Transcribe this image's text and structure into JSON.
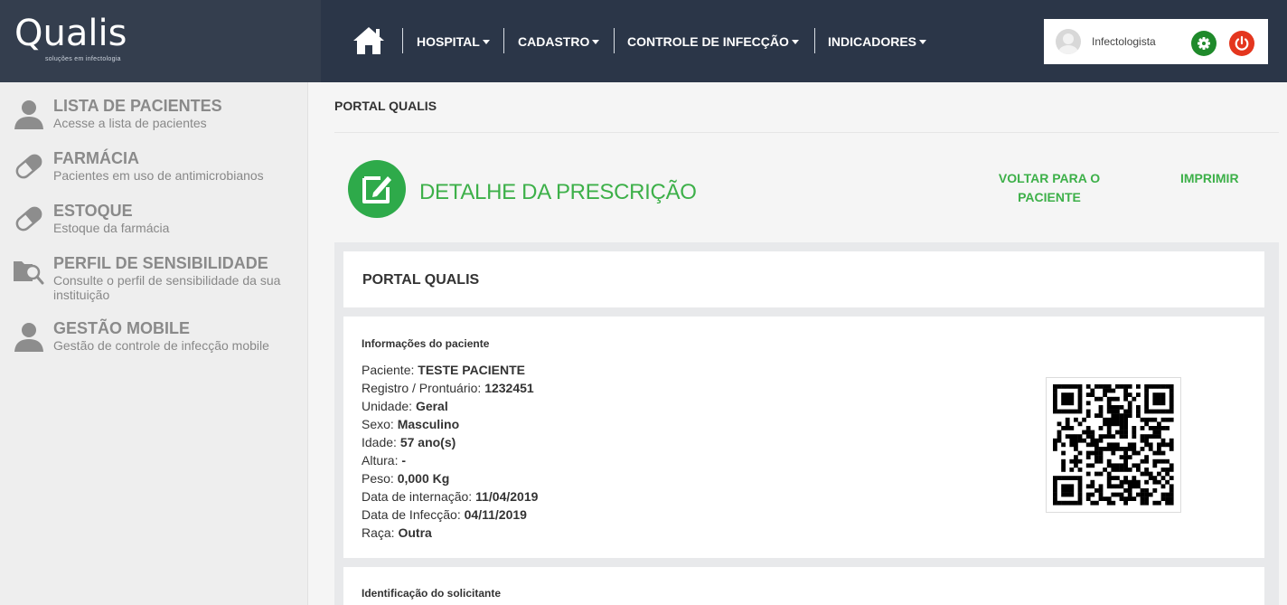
{
  "brand": {
    "name": "Qualis",
    "tagline": "soluções em infectologia"
  },
  "nav": {
    "home_icon": "home-icon",
    "items": [
      {
        "label": "HOSPITAL"
      },
      {
        "label": "CADASTRO"
      },
      {
        "label": "CONTROLE DE INFECÇÃO"
      },
      {
        "label": "INDICADORES"
      }
    ]
  },
  "user": {
    "name": "Infectologista",
    "settings_icon": "gear-icon",
    "logout_icon": "power-icon"
  },
  "sidebar": {
    "items": [
      {
        "title": "LISTA DE PACIENTES",
        "desc": "Acesse a lista de pacientes",
        "icon": "user-icon"
      },
      {
        "title": "FARMÁCIA",
        "desc": "Pacientes em uso de antimicrobianos",
        "icon": "pill-icon"
      },
      {
        "title": "ESTOQUE",
        "desc": "Estoque da farmácia",
        "icon": "pill-icon"
      },
      {
        "title": "PERFIL DE SENSIBILIDADE",
        "desc": "Consulte o perfil de sensibilidade da sua instituição",
        "icon": "folder-search-icon"
      },
      {
        "title": "GESTÃO MOBILE",
        "desc": "Gestão de controle de infecção mobile",
        "icon": "user-icon"
      }
    ]
  },
  "main": {
    "breadcrumb": "PORTAL QUALIS",
    "page_title": "DETALHE DA PRESCRIÇÃO",
    "actions": {
      "back": "VOLTAR PARA O PACIENTE",
      "print": "IMPRIMIR"
    },
    "card_title": "PORTAL QUALIS",
    "patient_section_title": "Informações do paciente",
    "patient_info": [
      {
        "label": "Paciente:",
        "value": "TESTE PACIENTE"
      },
      {
        "label": "Registro / Prontuário:",
        "value": "1232451"
      },
      {
        "label": "Unidade:",
        "value": "Geral"
      },
      {
        "label": "Sexo:",
        "value": "Masculino"
      },
      {
        "label": "Idade:",
        "value": "57 ano(s)"
      },
      {
        "label": "Altura:",
        "value": "-"
      },
      {
        "label": "Peso:",
        "value": "0,000 Kg"
      },
      {
        "label": "Data de internação:",
        "value": "11/04/2019"
      },
      {
        "label": "Data de Infecção:",
        "value": "04/11/2019"
      },
      {
        "label": "Raça:",
        "value": "Outra"
      }
    ],
    "requester_section_title": "Identificação do solicitante"
  },
  "colors": {
    "header_logo_bg": "#343e4e",
    "header_nav_bg": "#2b3648",
    "accent_green": "#3db049",
    "settings_green": "#1f8a2b",
    "logout_red": "#e4361e"
  }
}
